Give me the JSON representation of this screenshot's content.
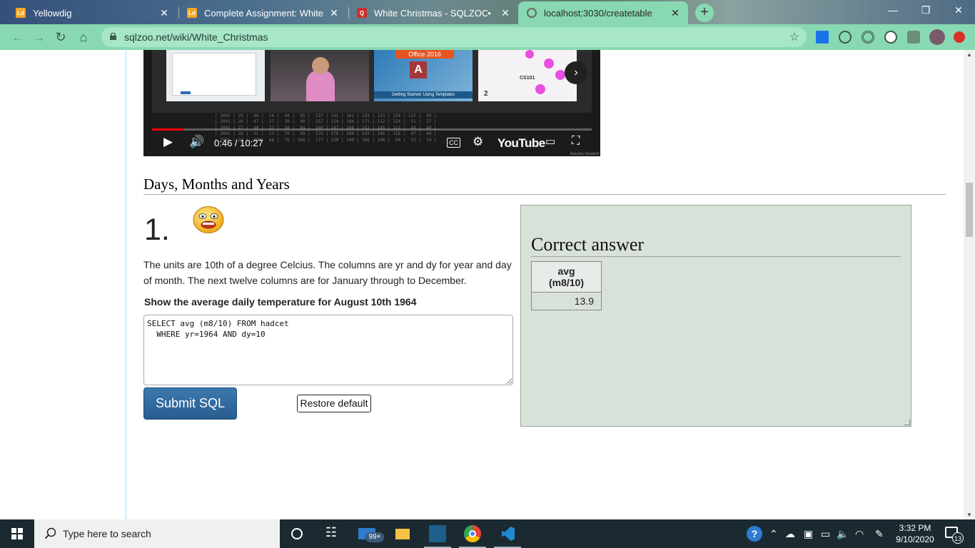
{
  "browser": {
    "tabs": [
      {
        "title": "Yellowdig",
        "favicon": "yellowdig-favicon",
        "active": false
      },
      {
        "title": "Complete Assignment: White Ch",
        "favicon": "yellowdig-favicon",
        "active": false
      },
      {
        "title": "White Christmas - SQLZOO",
        "favicon": "sqlzoo-favicon",
        "active": false
      },
      {
        "title": "localhost:3030/createtable",
        "favicon": "globe-icon",
        "active": true
      }
    ],
    "new_tab": "+",
    "url": "sqlzoo.net/wiki/White_Christmas",
    "accent": "#88d8b3"
  },
  "video": {
    "time": "0:46 / 10:27",
    "progress_fraction": 0.073,
    "logo": "YouTube",
    "thumb3_label": "Office 2016",
    "thumb3_caption": "Getting Started: Using Templates",
    "thumb4_caption": "CS101",
    "thumb4_number": "2",
    "autogen": "Autoplay Disabled"
  },
  "section": {
    "title": "Days, Months and Years"
  },
  "question": {
    "number": "1.",
    "description": "The units are 10th of a degree Celcius. The columns are yr and dy for year and day of month. The next twelve columns are for January through to December.",
    "instruction": "Show the average daily temperature for August 10th 1964",
    "sql": "SELECT avg (m8/10) FROM hadcet\n  WHERE yr=1964 AND dy=10",
    "submit_label": "Submit SQL",
    "restore_label": "Restore default"
  },
  "answer": {
    "title": "Correct answer",
    "column": "avg (m8/10)",
    "value": "13.9"
  },
  "taskbar": {
    "search_placeholder": "Type here to search",
    "mail_badge": "99+",
    "time": "3:32 PM",
    "date": "9/10/2020",
    "notification_count": "13"
  }
}
